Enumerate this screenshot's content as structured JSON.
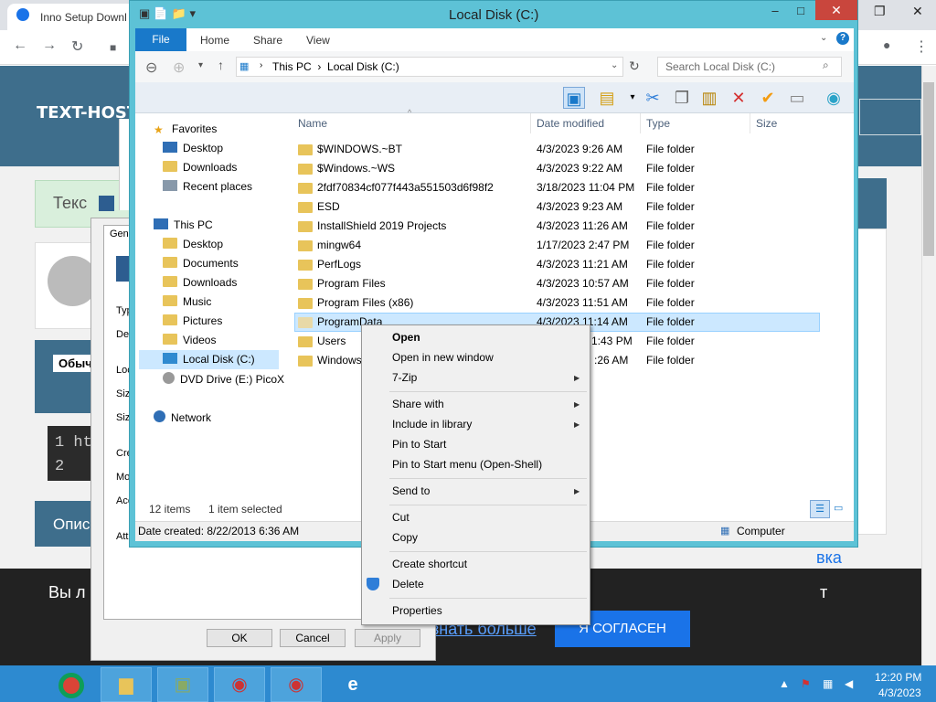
{
  "browser": {
    "tab_title": "Inno Setup Downl",
    "minimize": "–",
    "restore": "❐",
    "close": "✕"
  },
  "page": {
    "logo": "TEXT-HOST",
    "green_text": "Текс",
    "obych": "Обыч",
    "code_lines": [
      "1 ht",
      "2"
    ],
    "opis": "Опис",
    "right_link": "вка",
    "cookie_text": "Вы л",
    "cookie_t": "т",
    "learn_more": "знать больше",
    "agree": "Я СОГЛАСЕН"
  },
  "props": {
    "tab": "Gen",
    "labels": [
      "Typ",
      "De",
      "Loc",
      "Siz",
      "Siz",
      "Cre",
      "Mo",
      "Acc",
      "Att"
    ],
    "ok": "OK",
    "cancel": "Cancel",
    "apply": "Apply"
  },
  "explorer": {
    "title": "Local Disk (C:)",
    "ribbon_tabs": [
      "File",
      "Home",
      "Share",
      "View"
    ],
    "breadcrumb": [
      "This PC",
      "Local Disk (C:)"
    ],
    "search_placeholder": "Search Local Disk (C:)",
    "columns": [
      "Name",
      "Date modified",
      "Type",
      "Size"
    ],
    "nav": {
      "favorites": "Favorites",
      "fav_items": [
        "Desktop",
        "Downloads",
        "Recent places"
      ],
      "this_pc": "This PC",
      "pc_items": [
        "Desktop",
        "Documents",
        "Downloads",
        "Music",
        "Pictures",
        "Videos",
        "Local Disk (C:)",
        "DVD Drive (E:) PicoX"
      ],
      "network": "Network"
    },
    "files": [
      {
        "name": "$WINDOWS.~BT",
        "date": "4/3/2023 9:26 AM",
        "type": "File folder"
      },
      {
        "name": "$Windows.~WS",
        "date": "4/3/2023 9:22 AM",
        "type": "File folder"
      },
      {
        "name": "2fdf70834cf077f443a551503d6f98f2",
        "date": "3/18/2023 11:04 PM",
        "type": "File folder"
      },
      {
        "name": "ESD",
        "date": "4/3/2023 9:23 AM",
        "type": "File folder"
      },
      {
        "name": "InstallShield 2019 Projects",
        "date": "4/3/2023 11:26 AM",
        "type": "File folder"
      },
      {
        "name": "mingw64",
        "date": "1/17/2023 2:47 PM",
        "type": "File folder"
      },
      {
        "name": "PerfLogs",
        "date": "4/3/2023 11:21 AM",
        "type": "File folder"
      },
      {
        "name": "Program Files",
        "date": "4/3/2023 10:57 AM",
        "type": "File folder"
      },
      {
        "name": "Program Files (x86)",
        "date": "4/3/2023 11:51 AM",
        "type": "File folder"
      },
      {
        "name": "ProgramData",
        "date": "4/3/2023 11:14 AM",
        "type": "File folder"
      },
      {
        "name": "Users",
        "date": "1:43 PM",
        "type": "File folder"
      },
      {
        "name": "Windows",
        "date": ":26 AM",
        "type": "File folder"
      }
    ],
    "status_items": "12 items",
    "status_selected": "1 item selected",
    "info_created": "Date created: 8/22/2013 6:36 AM",
    "info_computer": "Computer"
  },
  "context_menu": [
    "Open",
    "Open in new window",
    "7-Zip",
    "Share with",
    "Include in library",
    "Pin to Start",
    "Pin to Start menu (Open-Shell)",
    "Send to",
    "Cut",
    "Copy",
    "Create shortcut",
    "Delete",
    "Properties"
  ],
  "taskbar": {
    "time": "12:20 PM",
    "date": "4/3/2023"
  }
}
